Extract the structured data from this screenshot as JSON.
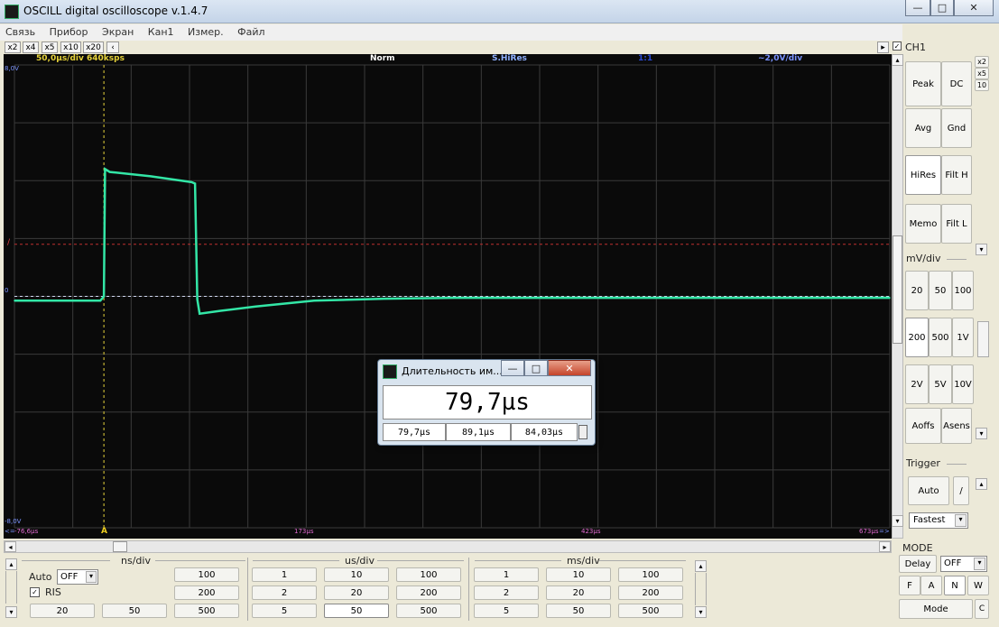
{
  "app": {
    "title": "OSCILL digital oscilloscope  v.1.4.7"
  },
  "menu": [
    "Связь",
    "Прибор",
    "Экран",
    "Кан1",
    "Измер.",
    "Файл"
  ],
  "zoom": [
    "x2",
    "x4",
    "x5",
    "x10",
    "x20",
    "‹"
  ],
  "scope": {
    "timebase": "50,0µs/div  640ksps",
    "mode": "Norm",
    "acq": "S.HiRes",
    "ratio": "1:1",
    "vdiv": "~2,0V/div",
    "ytop": "8,0V",
    "ybot": "-8,0V",
    "zero": "0",
    "trig_marker": "/",
    "t_left": "-76,6µs",
    "t_mid1": "173µs",
    "t_mid2": "423µs",
    "t_right": "673µs",
    "cursor": "A",
    "arrow_l": "<=",
    "arrow_r": "=>"
  },
  "chart_data": {
    "type": "line",
    "xlim_label": [
      "-76,6µs",
      "673µs"
    ],
    "series": [
      {
        "color": "#33e6a6",
        "x": [
          -76.6,
          -3,
          0,
          1,
          5,
          40,
          75,
          78,
          80,
          82,
          100,
          130,
          180,
          240,
          300,
          400,
          500,
          673
        ],
        "y": [
          -0.15,
          -0.15,
          0,
          4.4,
          4.3,
          4.15,
          3.95,
          3.9,
          -0.1,
          -0.6,
          -0.5,
          -0.35,
          -0.15,
          -0.08,
          -0.05,
          -0.05,
          -0.05,
          -0.05
        ]
      }
    ],
    "ylim": [
      -8,
      8
    ],
    "trigger_level": 1.8,
    "cursor_x": 0
  },
  "dialog": {
    "title": "Длительность им...",
    "value": "79,7µs",
    "v1": "79,7µs",
    "v2": "89,1µs",
    "v3": "84,03µs"
  },
  "right": {
    "ch": "CH1",
    "x2": "x2",
    "x5": "x5",
    "x10": "10",
    "b": [
      "Peak",
      "DC",
      "Avg",
      "Gnd",
      "HiRes",
      "Filt H",
      "Memo",
      "Filt L"
    ],
    "mv_label": "mV/div",
    "mv": [
      "20",
      "50",
      "100",
      "200",
      "500",
      "1V",
      "2V",
      "5V",
      "10V"
    ],
    "aoffs": "Aoffs",
    "asens": "Asens",
    "trigger": "Trigger",
    "auto": "Auto",
    "slope": "/",
    "speed": "Fastest",
    "mode_label": "MODE",
    "delay": "Delay",
    "delay_val": "OFF",
    "modes": [
      "F",
      "A",
      "N",
      "W"
    ],
    "mode_btn": "Mode",
    "c": "C"
  },
  "bottom": {
    "ns": "ns/div",
    "us": "us/div",
    "ms": "ms/div",
    "auto": "Auto",
    "auto_val": "OFF",
    "ris": "RIS",
    "ns_btns": [
      "100",
      "200",
      "500",
      "20",
      "50"
    ],
    "us_btns": [
      "1",
      "10",
      "100",
      "2",
      "20",
      "200",
      "5",
      "50",
      "500"
    ],
    "ms_btns": [
      "1",
      "10",
      "100",
      "2",
      "20",
      "200",
      "5",
      "50",
      "500"
    ]
  }
}
